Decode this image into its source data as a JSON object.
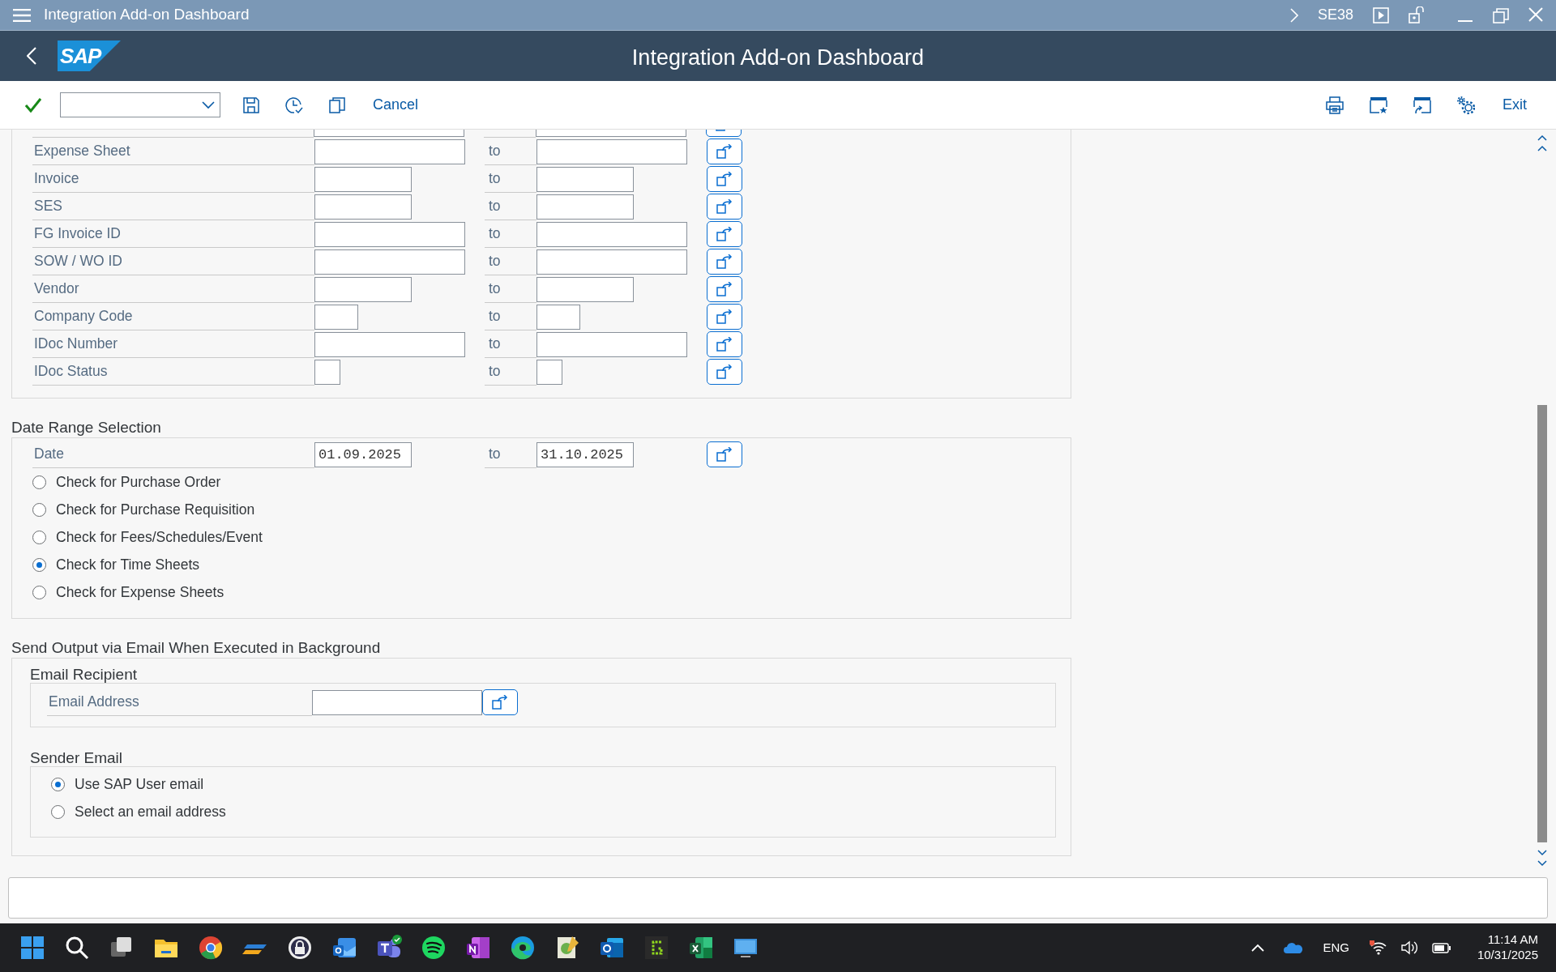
{
  "window": {
    "title": "Integration Add-on Dashboard",
    "transaction": "SE38"
  },
  "header": {
    "logo": "SAP",
    "title": "Integration Add-on Dashboard"
  },
  "toolbar": {
    "left_buttons": [
      "Cancel"
    ],
    "right_buttons": [
      "Exit"
    ]
  },
  "selection_rows": [
    {
      "kind": "cut"
    },
    {
      "kind": "long",
      "label": "Expense Sheet",
      "to_label": "to"
    },
    {
      "kind": "medium",
      "label": "Invoice",
      "to_label": "to"
    },
    {
      "kind": "medium",
      "label": "SES",
      "to_label": "to"
    },
    {
      "kind": "long",
      "label": "FG Invoice ID",
      "to_label": "to"
    },
    {
      "kind": "long",
      "label": "SOW / WO ID",
      "to_label": "to"
    },
    {
      "kind": "medium",
      "label": "Vendor",
      "to_label": "to"
    },
    {
      "kind": "short",
      "label": "Company Code",
      "to_label": "to"
    },
    {
      "kind": "long",
      "label": "IDoc Number",
      "to_label": "to"
    },
    {
      "kind": "tiny",
      "label": "IDoc Status",
      "to_label": "to"
    }
  ],
  "date_section": {
    "title": "Date Range Selection",
    "date": {
      "label": "Date",
      "from": "01.09.2025",
      "to_label": "to",
      "to": "31.10.2025"
    },
    "options": [
      {
        "label": "Check for Purchase Order",
        "selected": false
      },
      {
        "label": "Check for Purchase Requisition",
        "selected": false
      },
      {
        "label": "Check for Fees/Schedules/Event",
        "selected": false
      },
      {
        "label": "Check for Time Sheets",
        "selected": true
      },
      {
        "label": "Check for Expense Sheets",
        "selected": false
      }
    ]
  },
  "email_section": {
    "title": "Send Output via Email When Executed in Background",
    "recipient": {
      "title": "Email Recipient",
      "label": "Email Address"
    },
    "sender": {
      "title": "Sender Email",
      "options": [
        {
          "label": "Use SAP User email",
          "selected": true
        },
        {
          "label": "Select an email address",
          "selected": false
        }
      ]
    }
  },
  "taskbar": {
    "language": "ENG",
    "time": "11:14 AM",
    "date": "10/31/2025"
  }
}
